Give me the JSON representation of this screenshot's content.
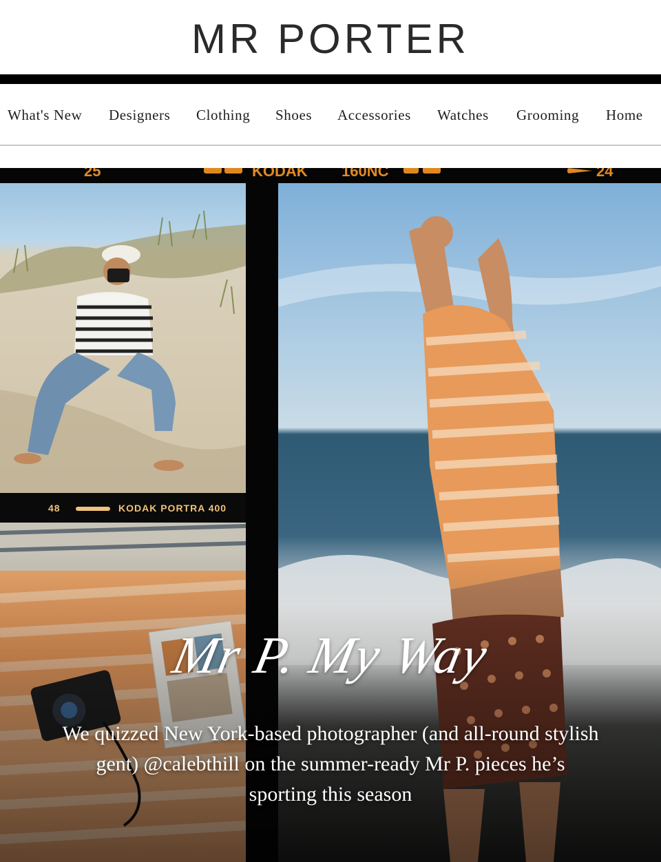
{
  "brand": {
    "logo_text": "MR PORTER"
  },
  "nav": {
    "items": [
      {
        "label": "What's New"
      },
      {
        "label": "Designers"
      },
      {
        "label": "Clothing"
      },
      {
        "label": "Shoes"
      },
      {
        "label": "Accessories"
      },
      {
        "label": "Watches"
      },
      {
        "label": "Grooming"
      },
      {
        "label": "Home"
      }
    ]
  },
  "hero": {
    "film_top": {
      "left_number": "25",
      "brand": "KODAK",
      "film": "160NC",
      "right_number": "24"
    },
    "film_mid": {
      "number": "48",
      "label": "KODAK PORTRA 400"
    },
    "script_title": "Mr P. My Way",
    "copy": "We quizzed New York-based photographer (and all-round stylish gent) @calebthill on the summer-ready Mr P. pieces he’s sporting this season"
  },
  "colors": {
    "film_orange": "#e0881e",
    "rule_black": "#000000",
    "nav_border": "#c9c9c9"
  }
}
